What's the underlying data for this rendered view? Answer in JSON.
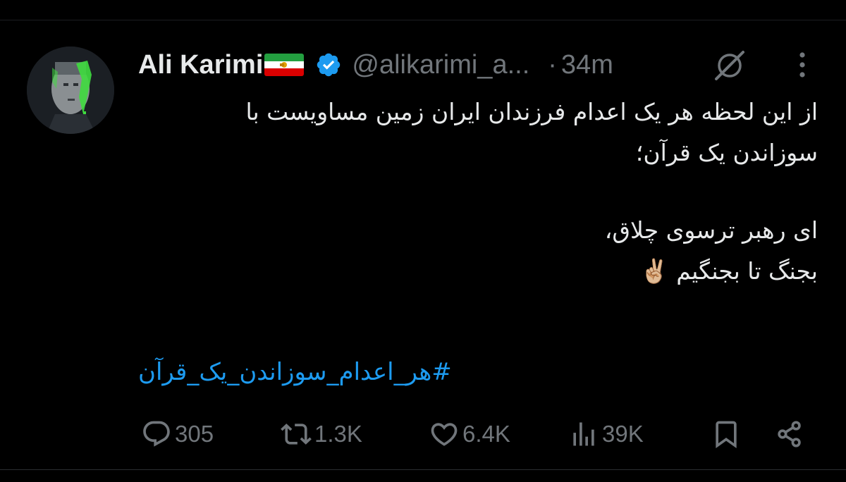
{
  "user": {
    "display_name": "Ali Karimi",
    "flag_icon": "iran-lion-and-sun-flag-icon",
    "verified_icon": "verified-badge-icon",
    "handle": "@alikarimi_a...",
    "separator": "·",
    "time": "34m"
  },
  "tweet": {
    "lines": [
      "از این لحظه هر یک اعدام فرزندان ایران زمین مساویست با",
      "سوزاندن یک قرآن؛",
      "ای رهبر ترسوی چلاق،",
      "بجنگ تا بجنگیم ✌🏼"
    ],
    "hashtag": "#هر_اعدام_سوزاندن_یک_قرآن"
  },
  "actions": {
    "replies": "305",
    "reposts": "1.3K",
    "likes": "6.4K",
    "views": "39K"
  },
  "colors": {
    "background": "#000000",
    "text": "#e7e9ea",
    "muted": "#71767b",
    "link": "#1d9bf0",
    "verified": "#1d9bf0"
  }
}
